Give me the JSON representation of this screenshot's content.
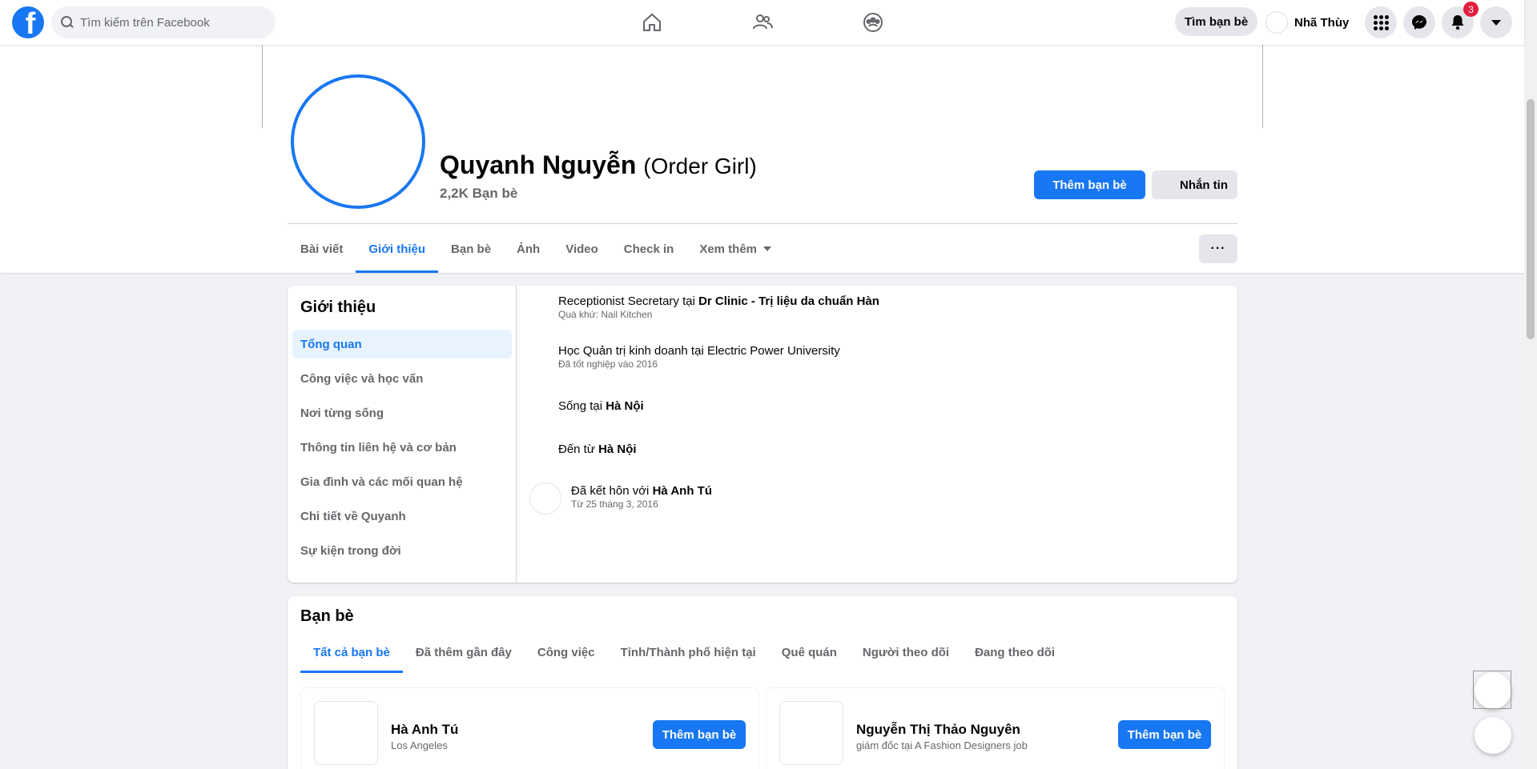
{
  "topbar": {
    "logo_letter": "f",
    "search_placeholder": "Tìm kiếm trên Facebook",
    "find_friends_label": "Tìm bạn bè",
    "user_name": "Nhã Thùy",
    "notification_count": "3"
  },
  "profile": {
    "name": "Quyanh Nguyễn",
    "nickname": "(Order Girl)",
    "friends_count": "2,2K Bạn bè",
    "add_friend_label": "Thêm bạn bè",
    "message_label": "Nhắn tin",
    "more_label": "···",
    "tabs": [
      "Bài viết",
      "Giới thiệu",
      "Bạn bè",
      "Ảnh",
      "Video",
      "Check in",
      "Xem thêm"
    ]
  },
  "about": {
    "title": "Giới thiệu",
    "menu": [
      "Tổng quan",
      "Công việc và học vấn",
      "Nơi từng sống",
      "Thông tin liên hệ và cơ bản",
      "Gia đình và các mối quan hệ",
      "Chi tiết về Quyanh",
      "Sự kiện trong đời"
    ],
    "work": {
      "prefix": "Receptionist Secretary tại ",
      "place": "Dr Clinic - Trị liệu da chuẩn Hàn",
      "sub": "Quá khứ: Nail Kitchen"
    },
    "study": {
      "text": "Học Quản trị kinh doanh tại Electric Power University",
      "sub": "Đã tốt nghiệp vào 2016"
    },
    "lives": {
      "prefix": "Sống tại ",
      "place": "Hà Nội"
    },
    "from": {
      "prefix": "Đến từ ",
      "place": "Hà Nội"
    },
    "married": {
      "prefix": "Đã kết hôn với ",
      "person": "Hà Anh Tú",
      "sub": "Từ 25 tháng 3, 2016"
    }
  },
  "friends": {
    "title": "Bạn bè",
    "tabs": [
      "Tất cả bạn bè",
      "Đã thêm gần đây",
      "Công việc",
      "Tỉnh/Thành phố hiện tại",
      "Quê quán",
      "Người theo dõi",
      "Đang theo dõi"
    ],
    "cards": [
      {
        "name": "Hà Anh Tú",
        "sub": "Los Angeles",
        "button": "Thêm bạn bè"
      },
      {
        "name": "Nguyễn Thị Thảo Nguyên",
        "sub": "giám đốc tại A Fashion Designers job",
        "button": "Thêm bạn bè"
      }
    ]
  },
  "colors": {
    "accent": "#1877f2",
    "background": "#f0f2f5",
    "badge": "#e41e3f"
  }
}
